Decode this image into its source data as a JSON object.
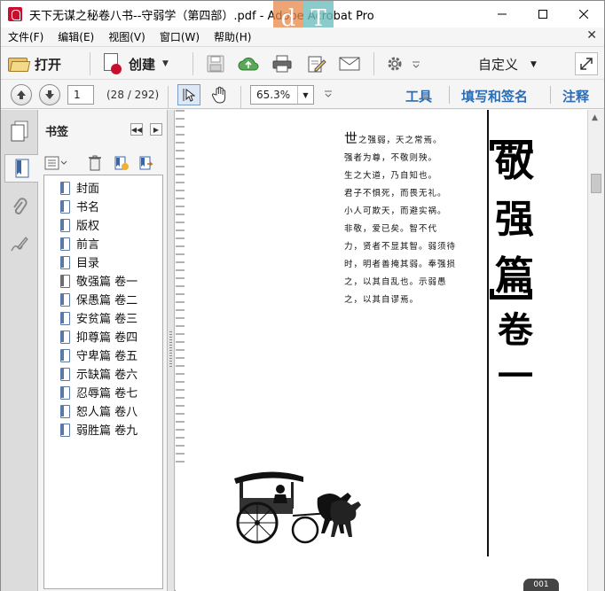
{
  "window": {
    "title": "天下无谋之秘卷八书--守弱学（第四部）.pdf - Adobe Acrobat Pro",
    "watermark": [
      "d",
      "T"
    ]
  },
  "menubar": {
    "items": [
      "文件(F)",
      "编辑(E)",
      "视图(V)",
      "窗口(W)",
      "帮助(H)"
    ]
  },
  "toolbar": {
    "open_label": "打开",
    "create_label": "创建",
    "customize_label": "自定义"
  },
  "nav": {
    "page_value": "1",
    "page_count": "(28 / 292)",
    "zoom_value": "65.3%",
    "tools_label": "工具",
    "fill_sign_label": "填写和签名",
    "comment_label": "注释"
  },
  "bookmarks": {
    "title": "书签",
    "items": [
      {
        "label": "封面",
        "current": false
      },
      {
        "label": "书名",
        "current": false
      },
      {
        "label": "版权",
        "current": false
      },
      {
        "label": "前言",
        "current": false
      },
      {
        "label": "目录",
        "current": false
      },
      {
        "label": "敬强篇 卷一",
        "current": true
      },
      {
        "label": "保愚篇 卷二",
        "current": false
      },
      {
        "label": "安贫篇 卷三",
        "current": false
      },
      {
        "label": "抑尊篇 卷四",
        "current": false
      },
      {
        "label": "守卑篇 卷五",
        "current": false
      },
      {
        "label": "示缺篇 卷六",
        "current": false
      },
      {
        "label": "忍辱篇 卷七",
        "current": false
      },
      {
        "label": "恕人篇 卷八",
        "current": false
      },
      {
        "label": "弱胜篇 卷九",
        "current": false
      }
    ]
  },
  "document": {
    "text_lines": [
      {
        "first": "世",
        "rest": "之强弱，天之常焉。"
      },
      {
        "first": "",
        "rest": "强者为尊，不敬则殃。"
      },
      {
        "first": "",
        "rest": "生之大道，乃自知也。"
      },
      {
        "first": "",
        "rest": "君子不惧死，而畏无礼。"
      },
      {
        "first": "",
        "rest": "小人可欺天，而避实祸。"
      },
      {
        "first": "",
        "rest": "非敬，爱已矣。智不代"
      },
      {
        "first": "",
        "rest": "力，贤者不显其智。弱须待"
      },
      {
        "first": "",
        "rest": "时，明者善掩其弱。奉强损"
      },
      {
        "first": "",
        "rest": "之，以其自乱也。示弱愚"
      },
      {
        "first": "",
        "rest": "之，以其自谬焉。"
      }
    ],
    "chapter_title": [
      "敬",
      "强",
      "篇"
    ],
    "volume": [
      "卷",
      "一"
    ],
    "page_number": "001"
  },
  "colors": {
    "link_blue": "#2c6db3",
    "acrobat_red": "#c8102e"
  }
}
